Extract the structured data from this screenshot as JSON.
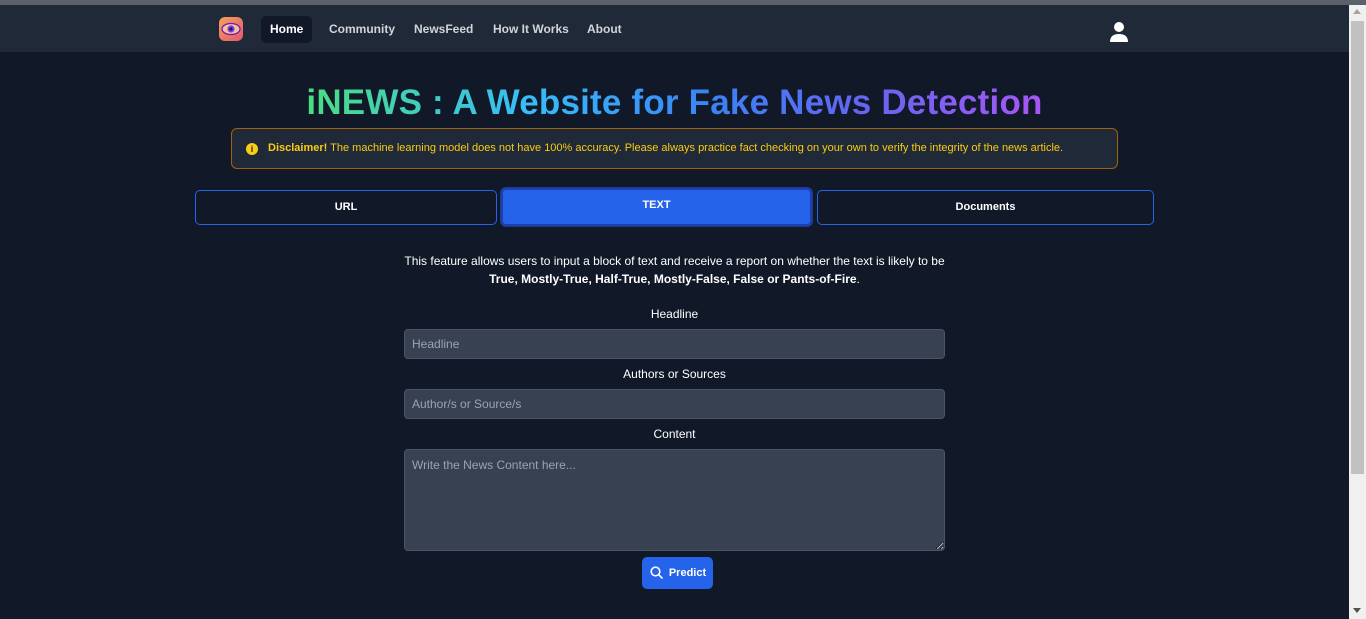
{
  "nav": {
    "items": [
      {
        "label": "Home",
        "active": true
      },
      {
        "label": "Community",
        "active": false
      },
      {
        "label": "NewsFeed",
        "active": false
      },
      {
        "label": "How It Works",
        "active": false
      },
      {
        "label": "About",
        "active": false
      }
    ]
  },
  "page": {
    "title": "iNEWS : A Website for Fake News Detection"
  },
  "disclaimer": {
    "strong": "Disclaimer!",
    "text": " The machine learning model does not have 100% accuracy. Please always practice fact checking on your own to verify the integrity of the news article."
  },
  "tabs": [
    {
      "label": "URL",
      "active": false
    },
    {
      "label": "TEXT",
      "active": true
    },
    {
      "label": "Documents",
      "active": false
    }
  ],
  "description": {
    "line1": "This feature allows users to input a block of text and receive a report on whether the text is likely to be",
    "line2_bold": "True, Mostly-True, Half-True, Mostly-False, False or Pants-of-Fire",
    "line2_end": "."
  },
  "form": {
    "headline_label": "Headline",
    "headline_placeholder": "Headline",
    "authors_label": "Authors or Sources",
    "authors_placeholder": "Author/s or Source/s",
    "content_label": "Content",
    "content_placeholder": "Write the News Content here...",
    "predict_label": "Predict"
  },
  "colors": {
    "background": "#111827",
    "navbar": "#1f2937",
    "accent": "#2563eb",
    "disclaimer_border": "#a16207",
    "disclaimer_text": "#facc15",
    "input_bg": "#374151"
  }
}
